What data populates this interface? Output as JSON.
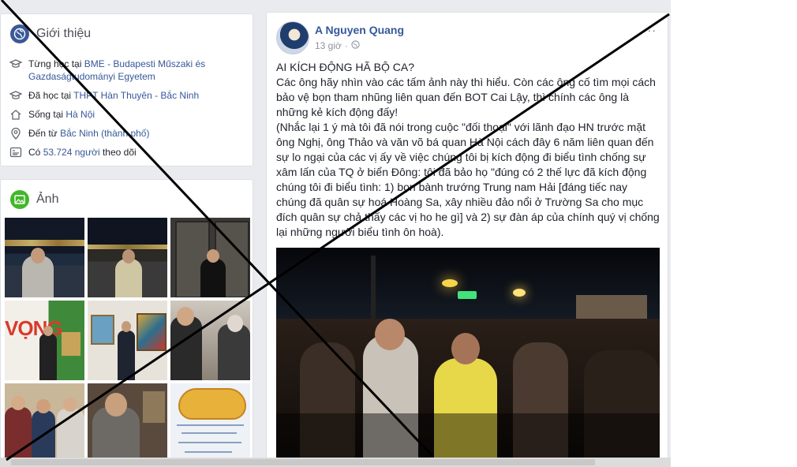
{
  "intro": {
    "title": "Giới thiệu",
    "rows": [
      {
        "icon": "graduation-cap-icon",
        "prefix": "Từng học tại ",
        "link": "BME - Budapesti Műszaki és Gazdaságtudományi Egyetem",
        "suffix": ""
      },
      {
        "icon": "graduation-cap-icon",
        "prefix": "Đã học tại ",
        "link": "THPT Hàn Thuyên - Bắc Ninh",
        "suffix": ""
      },
      {
        "icon": "home-icon",
        "prefix": "Sống tại ",
        "link": "Hà Nội",
        "suffix": ""
      },
      {
        "icon": "location-pin-icon",
        "prefix": "Đến từ ",
        "link": "Bắc Ninh (thành phố)",
        "suffix": ""
      },
      {
        "icon": "followers-icon",
        "prefix": "Có ",
        "link": "53.724 người",
        "suffix": " theo dõi"
      }
    ]
  },
  "photos": {
    "title": "Ảnh"
  },
  "post": {
    "author": "A Nguyen Quang",
    "time": "13 giờ",
    "more": "···",
    "lines": [
      "AI KÍCH ĐỘNG HÃ BỘ CA?",
      "Các ông hãy nhìn vào các tấm ảnh này thì hiểu. Còn các ông cố tìm mọi cách bảo vệ bọn tham nhũng liên quan đến BOT Cai Lậy, thì chính các ông là những kẻ kích động đấy!",
      "(Nhắc lại 1 ý mà tôi đã nói trong cuộc \"đối thoại\" với lãnh đạo HN trước mặt ông Nghị, ông Thảo và văn võ bá quan Hà Nội cách đây 6 năm liên quan đến sự lo ngại của các vị ấy về việc chúng tôi bị kích động đi biểu tình chống sự xâm lấn của TQ ở biển Đông: tôi đã bảo họ \"đúng có 2 thế lực đã kích động chúng tôi đi biểu tình: 1) bọn bành trướng Trung nam Hải [đáng tiếc nay chúng đã quân sự hoá Hoàng Sa, xây nhiều đảo nổi ở Trường Sa cho mục đích quân sự chả thấy các vị ho he gì] và 2) sự đàn áp của chính quý vị chống lại những người biểu tình ôn hoà)."
    ]
  },
  "colors": {
    "link": "#365899",
    "overlay_line": "#000000",
    "page_bg": "#e9ebee"
  }
}
